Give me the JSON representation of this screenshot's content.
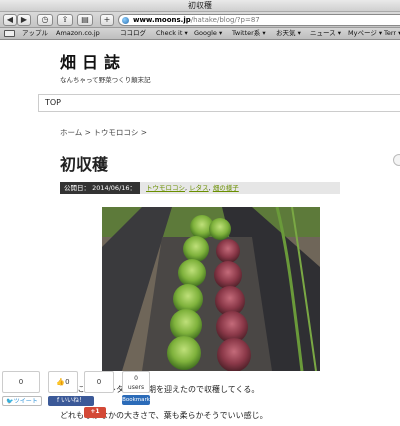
{
  "window": {
    "title": "初収穫"
  },
  "toolbar": {
    "url_domain": "www.moons.jp",
    "url_path": "/hatake/blog/?p=87"
  },
  "bookmarks": [
    "アップル",
    "Amazon.co.jp",
    "ココログ",
    "Check it ▾",
    "Google ▾",
    "Twitter系 ▾",
    "お天気 ▾",
    "ニュース ▾",
    "Myページ ▾",
    "Terr ▾"
  ],
  "site": {
    "title": "畑日誌",
    "subtitle": "なんちゃって野菜つくり顛末記",
    "nav_top": "TOP"
  },
  "post": {
    "breadcrumb": "ホーム > トウモロコシ >",
    "title": "初収穫",
    "date_label": "公開日： 2014/06/16：",
    "categories": [
      "トウモロコシ",
      "レタス",
      "畑の様子"
    ],
    "category_sep": ", ",
    "body_line1": "最初に植えたレタスが適期を迎えたので収穫してくる。",
    "body_line2": "どれもなかなかの大きさで、葉も柔らかそうでいい感じ。"
  },
  "share": {
    "tweet_count": "0",
    "tweet_label": "ツイート",
    "like_count": "0",
    "like_label": "いいね！",
    "gplus_label": "+1",
    "gplus_count": "0",
    "hatena_count": "0",
    "hatena_users": "users",
    "hatena_label": "Bookmark"
  },
  "colors": {
    "category_link": "#6a8f00",
    "date_bg": "#333333",
    "twitter": "#2a8fd6",
    "facebook": "#3b5998",
    "gplus": "#d34836",
    "hatena": "#2b6bb8"
  }
}
